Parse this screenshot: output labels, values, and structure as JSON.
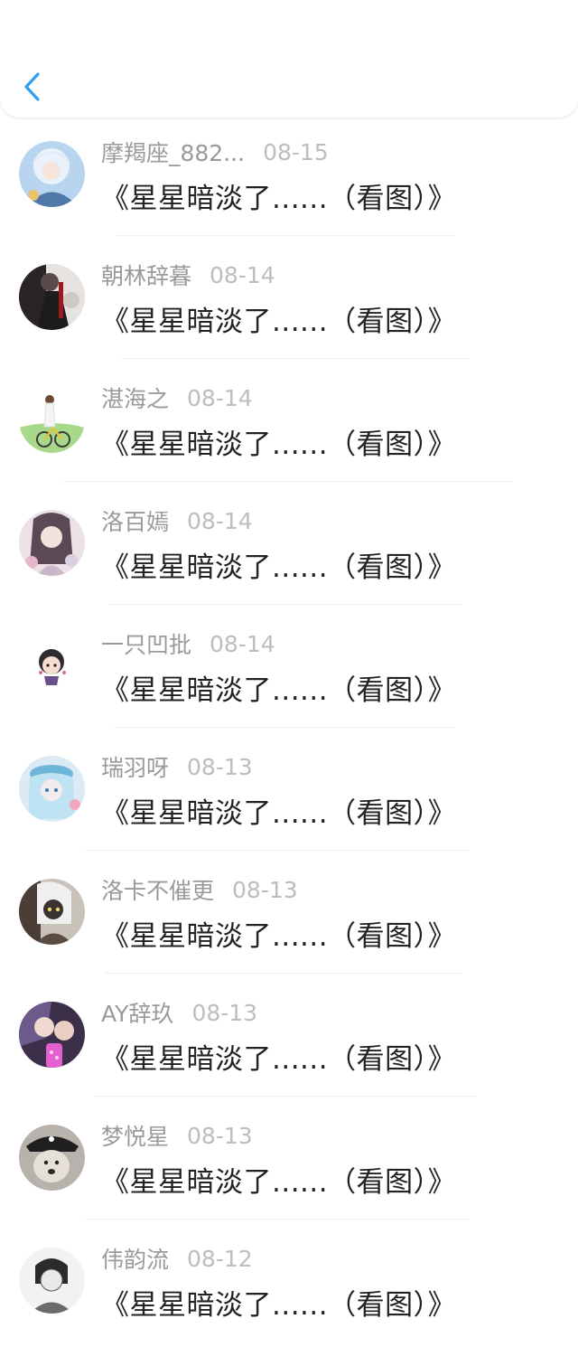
{
  "header": {
    "back_icon": "chevron-left-icon",
    "accent": "#2f9ff0"
  },
  "items": [
    {
      "name": "摩羯座_882...",
      "date": "08-15",
      "title": "《星星暗淡了......（看图）》",
      "avatar": "anime-boy-white-hair"
    },
    {
      "name": "朝林辞暮",
      "date": "08-14",
      "title": "《星星暗淡了......（看图）》",
      "avatar": "dark-anime-couple"
    },
    {
      "name": "湛海之",
      "date": "08-14",
      "title": "《星星暗淡了......（看图）》",
      "avatar": "girl-with-bicycle"
    },
    {
      "name": "洛百嫣",
      "date": "08-14",
      "title": "《星星暗淡了......（看图）》",
      "avatar": "girl-with-flowers"
    },
    {
      "name": "一只凹批",
      "date": "08-14",
      "title": "《星星暗淡了......（看图）》",
      "avatar": "chibi-character"
    },
    {
      "name": "瑞羽呀",
      "date": "08-13",
      "title": "《星星暗淡了......（看图）》",
      "avatar": "blue-haired-anime-girl"
    },
    {
      "name": "洛卡不催更",
      "date": "08-13",
      "title": "《星星暗淡了......（看图）》",
      "avatar": "masked-character"
    },
    {
      "name": "AY辞玖",
      "date": "08-13",
      "title": "《星星暗淡了......（看图）》",
      "avatar": "anime-duo"
    },
    {
      "name": "梦悦星",
      "date": "08-13",
      "title": "《星星暗淡了......（看图）》",
      "avatar": "pirate-dog"
    },
    {
      "name": "伟韵流",
      "date": "08-12",
      "title": "《星星暗淡了......（看图）》",
      "avatar": "sketch-portrait"
    }
  ]
}
